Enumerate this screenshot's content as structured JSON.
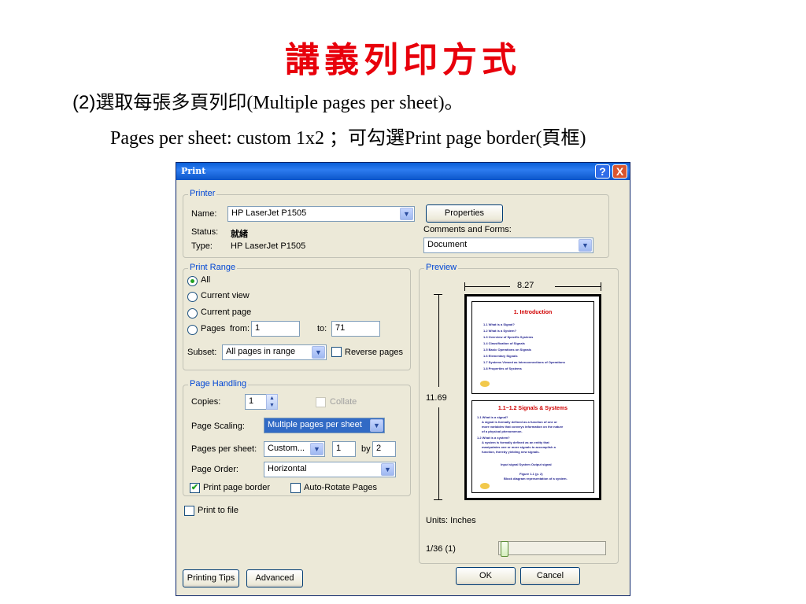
{
  "slide": {
    "title": "講義列印方式",
    "line1_prefix": "(2)",
    "line1_text": "選取每張多頁列印(Multiple pages per sheet)。",
    "line2": "Pages per sheet: custom 1x2 ；可勾選Print page border(頁框)"
  },
  "dialog": {
    "title": "Print",
    "help_icon": "?",
    "close_icon": "X",
    "printer": {
      "group_label": "Printer",
      "name_label": "Name:",
      "name_value": "HP LaserJet P1505",
      "status_label": "Status:",
      "status_value": "就緒",
      "type_label": "Type:",
      "type_value": "HP LaserJet P1505",
      "properties_button": "Properties",
      "comments_label": "Comments and Forms:",
      "comments_value": "Document"
    },
    "print_range": {
      "group_label": "Print Range",
      "options": [
        "All",
        "Current view",
        "Current page",
        "Pages"
      ],
      "selected": "All",
      "from_label": "from:",
      "from_value": "1",
      "to_label": "to:",
      "to_value": "71",
      "subset_label": "Subset:",
      "subset_value": "All pages in range",
      "reverse_label": "Reverse pages"
    },
    "page_handling": {
      "group_label": "Page Handling",
      "copies_label": "Copies:",
      "copies_value": "1",
      "collate_label": "Collate",
      "scaling_label": "Page Scaling:",
      "scaling_value": "Multiple pages per sheet",
      "per_sheet_label": "Pages per sheet:",
      "per_sheet_value": "Custom...",
      "cols": "1",
      "by_label": "by",
      "rows": "2",
      "order_label": "Page Order:",
      "order_value": "Horizontal",
      "border_label": "Print page border",
      "border_checked": true,
      "autorotate_label": "Auto-Rotate Pages",
      "autorotate_checked": false
    },
    "print_to_file": "Print to file",
    "preview": {
      "group_label": "Preview",
      "width": "8.27",
      "height": "11.69",
      "units": "Units: Inches",
      "page_counter": "1/36 (1)",
      "slider_fraction": 0.0,
      "page1": {
        "title": "1. Introduction",
        "items": [
          "1.1 What is a Signal?",
          "1.2 What is a System?",
          "1.3 Overview of Specific Systems",
          "1.4 Classification of Signals",
          "1.5 Basic Operations on Signals",
          "1.6 Elementary Signals",
          "1.7 Systems Viewed as Interconnections of Operations",
          "1.8 Properties of Systems"
        ]
      },
      "page2": {
        "title": "1.1~1.2 Signals & Systems",
        "items": [
          "1.1 What is a signal?",
          "A signal is formally defined as a function of one or",
          "more variables that conveys information on the nature",
          "of a physical phenomenon.",
          "1.2 What is a system?",
          "A system is formally defined as an entity that",
          "manipulates one or more signals to accomplish a",
          "function, thereby yielding new signals.",
          "Input signal    System    Output signal",
          "Figure 1.1 (p. 2)",
          "Block diagram representation of a system."
        ]
      }
    },
    "buttons": {
      "printing_tips": "Printing Tips",
      "advanced": "Advanced",
      "ok": "OK",
      "cancel": "Cancel"
    }
  }
}
